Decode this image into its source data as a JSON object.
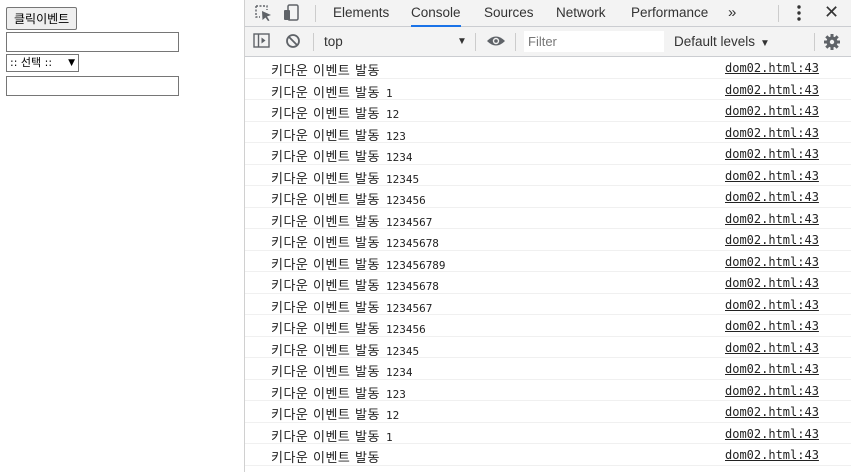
{
  "page": {
    "click_button_label": "클릭이벤트",
    "input1_value": "",
    "select_value": ":: 선택 ::",
    "input2_value": ""
  },
  "devtools": {
    "tabs": [
      "Elements",
      "Console",
      "Sources",
      "Network",
      "Performance"
    ],
    "active_tab": "Console",
    "more_tabs": "»",
    "context": "top",
    "filter_placeholder": "Filter",
    "levels_label": "Default levels"
  },
  "console": {
    "message": "키다운 이벤트 발동",
    "source": "dom02.html:43",
    "values": [
      "",
      "1",
      "12",
      "123",
      "1234",
      "12345",
      "123456",
      "1234567",
      "12345678",
      "123456789",
      "12345678",
      "1234567",
      "123456",
      "12345",
      "1234",
      "123",
      "12",
      "1",
      ""
    ]
  },
  "colors": {
    "accent": "#1a73e8",
    "toolbar_bg": "#f3f3f3"
  }
}
